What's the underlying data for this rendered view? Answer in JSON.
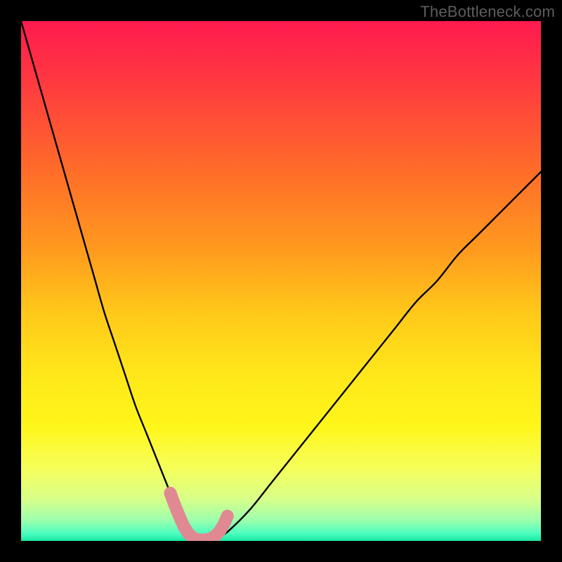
{
  "watermark": "TheBottleneck.com",
  "chart_data": {
    "type": "line",
    "title": "",
    "xlabel": "",
    "ylabel": "",
    "xlim": [
      0,
      100
    ],
    "ylim": [
      0,
      100
    ],
    "grid": false,
    "series": [
      {
        "name": "curve",
        "x": [
          0,
          2,
          4,
          6,
          8,
          10,
          12,
          14,
          16,
          18,
          20,
          22,
          24,
          26,
          28,
          29,
          30,
          31,
          32,
          33,
          34,
          35,
          36,
          37,
          38,
          40,
          44,
          48,
          52,
          56,
          60,
          64,
          68,
          72,
          76,
          80,
          84,
          88,
          92,
          96,
          100
        ],
        "y": [
          100,
          93,
          86,
          79,
          72,
          65,
          58,
          51,
          44,
          38,
          32,
          26,
          21,
          16,
          11,
          8.5,
          6,
          3.5,
          1.5,
          0.2,
          0,
          0,
          0,
          0.2,
          0.6,
          2,
          6,
          11,
          16,
          21,
          26,
          31,
          36,
          41,
          46,
          50,
          55,
          59,
          63,
          67,
          71
        ]
      }
    ],
    "marker_region": {
      "name": "highlight",
      "color": "#e08993",
      "x": [
        28.7,
        29.6,
        30.5,
        31.3,
        32.2,
        33.1,
        34.1,
        35.3,
        36.4,
        37.4,
        38.3,
        39.1,
        39.7
      ],
      "y": [
        9.2,
        6.8,
        4.6,
        2.8,
        1.4,
        0.6,
        0.2,
        0.2,
        0.4,
        1.0,
        2.0,
        3.4,
        4.8
      ]
    },
    "gradient_stops": [
      {
        "offset": 0.0,
        "color": "#ff1a4f"
      },
      {
        "offset": 0.12,
        "color": "#ff3a3f"
      },
      {
        "offset": 0.28,
        "color": "#ff6a2a"
      },
      {
        "offset": 0.44,
        "color": "#ff9a1e"
      },
      {
        "offset": 0.56,
        "color": "#ffc81a"
      },
      {
        "offset": 0.68,
        "color": "#ffe71a"
      },
      {
        "offset": 0.78,
        "color": "#fff61a"
      },
      {
        "offset": 0.86,
        "color": "#f6ff5a"
      },
      {
        "offset": 0.92,
        "color": "#d7ff8a"
      },
      {
        "offset": 0.96,
        "color": "#9dffad"
      },
      {
        "offset": 0.985,
        "color": "#4effc0"
      },
      {
        "offset": 1.0,
        "color": "#18e8a3"
      }
    ]
  }
}
